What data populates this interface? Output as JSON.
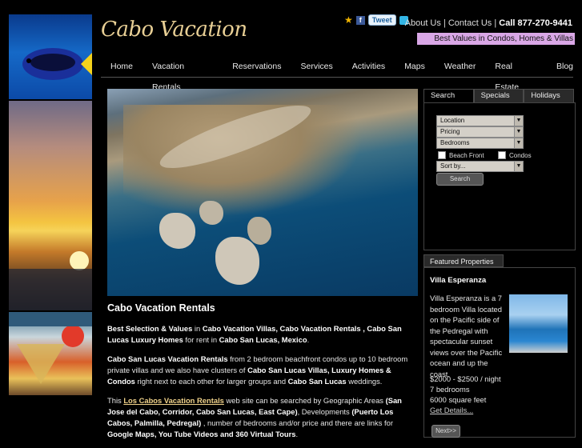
{
  "logo": "Cabo Vacation",
  "top": {
    "about": "About Us",
    "contact": "Contact Us",
    "phone": "Call 877-270-9441",
    "tweet": "Tweet",
    "banner": "Best Values in Condos, Homes & Villas"
  },
  "nav": [
    "Home",
    "Vacation Rentals",
    "Reservations",
    "Services",
    "Activities",
    "Maps",
    "Weather",
    "Real Estate",
    "Blog"
  ],
  "content": {
    "title": "Cabo Vacation Rentals",
    "p1": [
      {
        "t": "Best Selection & Values",
        "b": true
      },
      {
        "t": " in ",
        "b": false
      },
      {
        "t": "Cabo Vacation Villas, Cabo Vacation Rentals , Cabo San Lucas Luxury Homes",
        "b": true
      },
      {
        "t": " for rent in ",
        "b": false
      },
      {
        "t": "Cabo San Lucas, Mexico",
        "b": true
      },
      {
        "t": ".",
        "b": false
      }
    ],
    "p2": [
      {
        "t": "Cabo San Lucas Vacation Rentals",
        "b": true
      },
      {
        "t": " from 2 bedroom beachfront condos up to 10 bedroom private villas and we also have clusters of ",
        "b": false
      },
      {
        "t": "Cabo San Lucas Villas, Luxury Homes & Condos",
        "b": true
      },
      {
        "t": " right next to each other for larger groups and ",
        "b": false
      },
      {
        "t": "Cabo San Lucas",
        "b": true
      },
      {
        "t": " weddings.",
        "b": false
      }
    ],
    "p3": [
      {
        "t": "This ",
        "b": false
      },
      {
        "t": "Los Cabos Vacation Rentals",
        "b": true,
        "link": true
      },
      {
        "t": " web site can be searched by Geographic Areas ",
        "b": false
      },
      {
        "t": "(San Jose del Cabo, Corridor, Cabo San Lucas, East Cape)",
        "b": true
      },
      {
        "t": ", Developments ",
        "b": false
      },
      {
        "t": "(Puerto Los Cabos, Palmilla, Pedregal)",
        "b": true
      },
      {
        "t": " , number of bedrooms and/or price and there are links for ",
        "b": false
      },
      {
        "t": "Google Maps, You Tube Videos and 360 Virtual Tours",
        "b": true
      },
      {
        "t": ".",
        "b": false
      }
    ]
  },
  "search": {
    "tabs": [
      "Search",
      "Specials",
      "Holidays"
    ],
    "location": "Location",
    "pricing": "Pricing",
    "bedrooms": "Bedrooms",
    "beachfront": "Beach Front",
    "condos": "Condos",
    "sort": "Sort by...",
    "button": "Search"
  },
  "featured": {
    "tab": "Featured Properties",
    "name": "Villa Esperanza",
    "description": "Villa Esperanza is a 7 bedroom Villa located on the Pacific side of the Pedregal with spectacular sunset views over the Pacific ocean and up the coast.",
    "price": "$2000 - $2500 / night",
    "bedrooms": "7 bedrooms",
    "size": "6000 square feet",
    "details": "Get Details...",
    "next": "Next>>"
  }
}
